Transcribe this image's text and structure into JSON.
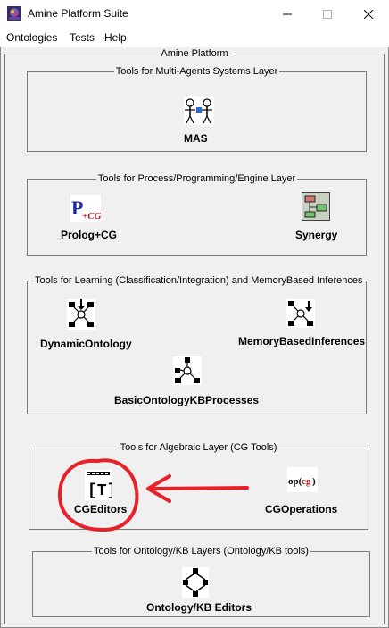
{
  "window": {
    "title": "Amine Platform Suite"
  },
  "menubar": {
    "items": [
      "Ontologies",
      "Tests",
      "Help"
    ]
  },
  "platform": {
    "title": "Amine Platform"
  },
  "groups": {
    "mas": {
      "title": "Tools for Multi-Agents Systems Layer",
      "tools": {
        "mas": "MAS"
      }
    },
    "process": {
      "title": "Tools for Process/Programming/Engine Layer",
      "tools": {
        "prolog": "Prolog+CG",
        "synergy": "Synergy"
      }
    },
    "learning": {
      "title": "Tools for Learning (Classification/Integration) and MemoryBased Inferences",
      "tools": {
        "dynamic": "DynamicOntology",
        "memory": "MemoryBasedInferences",
        "basic": "BasicOntologyKBProcesses"
      }
    },
    "algebraic": {
      "title": "Tools for Algebraic Layer (CG Tools)",
      "tools": {
        "cgeditors": "CGEditors",
        "cgoperations": "CGOperations"
      }
    },
    "ontology": {
      "title": "Tools for Ontology/KB Layers (Ontology/KB tools)",
      "tools": {
        "editors": "Ontology/KB Editors"
      }
    }
  },
  "icons": {
    "prolog_text": "P+CG",
    "cgeditors_text": "[T]",
    "cgoperations_text": "op(cg)"
  },
  "annotation": {
    "color": "#e8202a"
  }
}
